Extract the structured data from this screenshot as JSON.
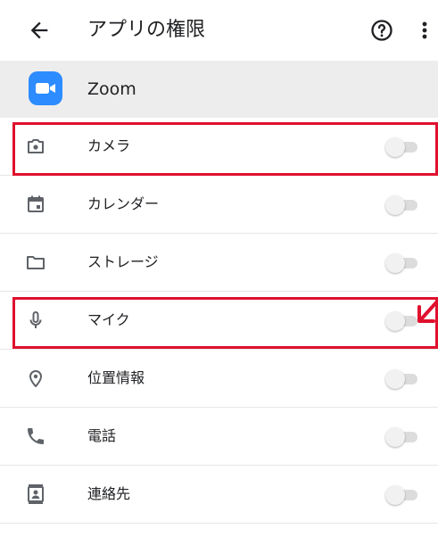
{
  "toolbar": {
    "title": "アプリの権限",
    "back_icon": "arrow-left-icon",
    "help_icon": "help-circle-icon",
    "more_icon": "more-vert-icon"
  },
  "app": {
    "name": "Zoom",
    "icon": "zoom-camera-icon",
    "icon_color": "#2d8cff"
  },
  "permissions": [
    {
      "label": "カメラ",
      "icon": "camera-icon",
      "enabled": false,
      "highlighted": true
    },
    {
      "label": "カレンダー",
      "icon": "calendar-icon",
      "enabled": false,
      "highlighted": false
    },
    {
      "label": "ストレージ",
      "icon": "folder-icon",
      "enabled": false,
      "highlighted": false
    },
    {
      "label": "マイク",
      "icon": "microphone-icon",
      "enabled": false,
      "highlighted": true
    },
    {
      "label": "位置情報",
      "icon": "location-pin-icon",
      "enabled": false,
      "highlighted": false
    },
    {
      "label": "電話",
      "icon": "phone-icon",
      "enabled": false,
      "highlighted": false
    },
    {
      "label": "連絡先",
      "icon": "contacts-icon",
      "enabled": false,
      "highlighted": false
    }
  ],
  "colors": {
    "highlight": "#e0102e",
    "header_bg": "#ededed",
    "toggle_track_off": "#dcdcdc"
  }
}
